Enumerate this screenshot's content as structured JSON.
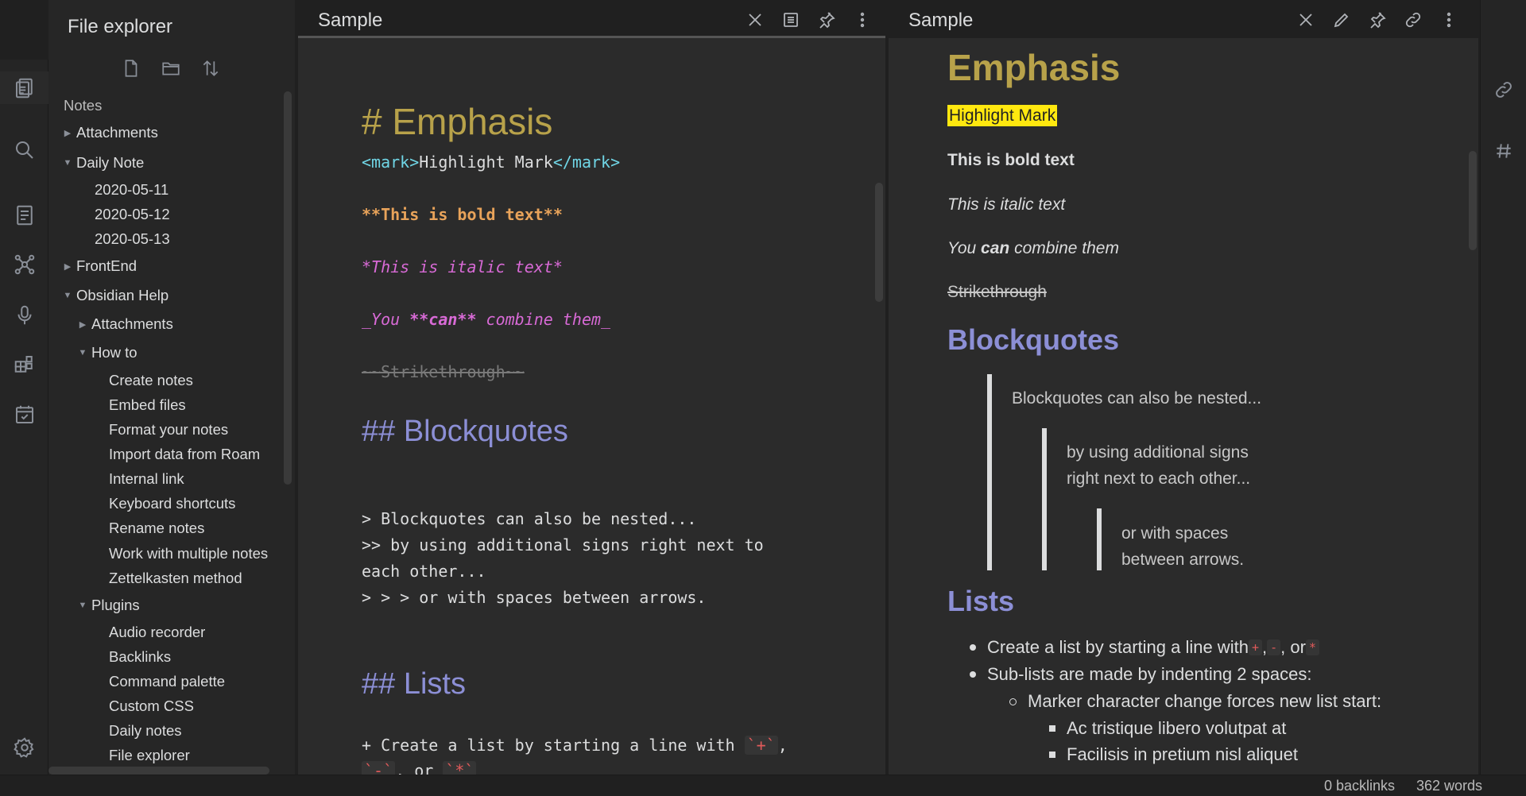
{
  "ribbon": {
    "icons": [
      "files-icon",
      "search-icon",
      "outline-icon",
      "graph-icon",
      "microphone-icon",
      "blocks-icon",
      "calendar-check-icon",
      "settings-icon"
    ]
  },
  "explorer": {
    "title": "File explorer",
    "actions": [
      "new-note-icon",
      "new-folder-icon",
      "sort-icon"
    ],
    "root": "Notes",
    "items": [
      {
        "label": "Attachments",
        "caret": "▶"
      },
      {
        "label": "Daily Note",
        "caret": "▼"
      },
      {
        "label": "2020-05-11"
      },
      {
        "label": "2020-05-12"
      },
      {
        "label": "2020-05-13"
      },
      {
        "label": "FrontEnd",
        "caret": "▶"
      },
      {
        "label": "Obsidian Help",
        "caret": "▼"
      },
      {
        "label": "Attachments",
        "caret": "▶"
      },
      {
        "label": "How to",
        "caret": "▼"
      },
      {
        "label": "Create notes"
      },
      {
        "label": "Embed files"
      },
      {
        "label": "Format your notes"
      },
      {
        "label": "Import data from Roam"
      },
      {
        "label": "Internal link"
      },
      {
        "label": "Keyboard shortcuts"
      },
      {
        "label": "Rename notes"
      },
      {
        "label": "Work with multiple notes"
      },
      {
        "label": "Zettelkasten method"
      },
      {
        "label": "Plugins",
        "caret": "▼"
      },
      {
        "label": "Audio recorder"
      },
      {
        "label": "Backlinks"
      },
      {
        "label": "Command palette"
      },
      {
        "label": "Custom CSS"
      },
      {
        "label": "Daily notes"
      },
      {
        "label": "File explorer"
      }
    ]
  },
  "left_pane": {
    "title": "Sample",
    "source": {
      "h1": "# Emphasis",
      "mark_open": "<mark>",
      "mark_text": "Highlight Mark",
      "mark_close": "</mark>",
      "bold": "**This is bold text**",
      "italic": "*This is italic text*",
      "combine_a": "_You ",
      "combine_b": "**can**",
      "combine_c": " combine them_",
      "strike": "~~Strikethrough~~",
      "h2_blockquotes": "## Blockquotes",
      "quote1": "> Blockquotes can also be nested...",
      "quote2": ">> by using additional signs right next to",
      "quote3": "each other...",
      "quote4": "> > > or with spaces between arrows.",
      "h2_lists": "## Lists",
      "list1": "+ Create a list by starting a line with ",
      "code_plus": "`+`",
      "comma": ",",
      "code_minus": "`-`",
      "or": ", or ",
      "code_star": "`*`"
    }
  },
  "right_pane": {
    "title": "Sample",
    "preview": {
      "h1": "Emphasis",
      "highlight": "Highlight Mark",
      "bold": "This is bold text",
      "italic": "This is italic text",
      "combine_a": "You ",
      "combine_b": "can",
      "combine_c": " combine them",
      "strike": "Strikethrough",
      "h2_blockquotes": "Blockquotes",
      "quote1": "Blockquotes can also be nested...",
      "quote2": "by using additional signs right next to each other...",
      "quote3": "or with spaces between arrows.",
      "h2_lists": "Lists",
      "list1_a": "Create a list by starting a line with ",
      "list1_plus": "+",
      "list1_sep1": ", ",
      "list1_minus": "-",
      "list1_sep2": ", or ",
      "list1_star": "*",
      "list2": "Sub-lists are made by indenting 2 spaces:",
      "list3": "Marker character change forces new list start:",
      "list4": "Ac tristique libero volutpat at",
      "list5": "Facilisis in pretium nisl aliquet"
    }
  },
  "statusbar": {
    "backlinks": "0 backlinks",
    "words": "362 words"
  },
  "colors": {
    "h1": "#b8a24a",
    "h2": "#8c8fd6",
    "bold_src": "#e8a35a",
    "italic_src": "#d86ad6",
    "highlight": "#ffe80f"
  }
}
